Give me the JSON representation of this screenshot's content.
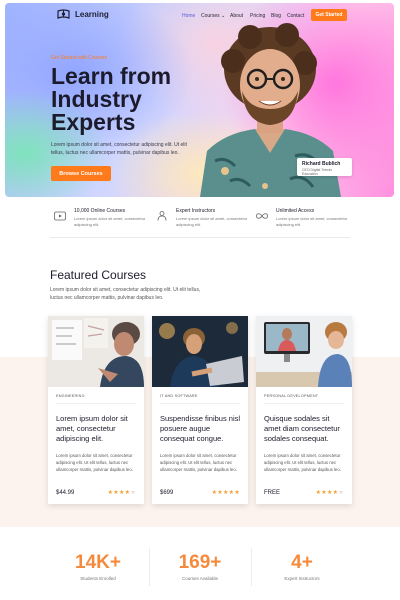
{
  "brand": {
    "name": "Learning"
  },
  "nav": {
    "items": [
      {
        "label": "Home",
        "active": true
      },
      {
        "label": "Courses ⌄",
        "active": false
      },
      {
        "label": "About",
        "active": false
      },
      {
        "label": "Pricing",
        "active": false
      },
      {
        "label": "Blog",
        "active": false
      },
      {
        "label": "Contact",
        "active": false
      }
    ],
    "cta": "Get Started"
  },
  "hero": {
    "eyebrow": "Get Started with Courses",
    "title": "Learn from Industry Experts",
    "description": "Lorem ipsum dolor sit amet, consectetur adipiscing elit. Ut elit tellus, luctus nec ullamcorper mattis, pulvinar dapibus leo.",
    "button": "Browse Courses",
    "badge": {
      "name": "Richard Bublich",
      "role": "CEO Digital Trends Education"
    }
  },
  "features": [
    {
      "icon": "video-icon",
      "title": "10,000 Online Courses",
      "desc": "Lorem ipsum dolor sit amet, consectetur adipiscing elit."
    },
    {
      "icon": "instructor-icon",
      "title": "Expert Instructors",
      "desc": "Lorem ipsum dolor sit amet, consectetur adipiscing elit."
    },
    {
      "icon": "infinity-icon",
      "title": "Unlimited Access",
      "desc": "Lorem ipsum dolor sit amet, consectetur adipiscing elit."
    }
  ],
  "featured": {
    "title": "Featured Courses",
    "description": "Lorem ipsum dolor sit amet, consectetur adipiscing elit. Ut elit tellus, luctus nec ullamcorper mattis, pulvinar dapibus leo."
  },
  "courses": [
    {
      "category": "ENGINEERING",
      "title": "Lorem ipsum dolor sit amet, consectetur adipiscing elit.",
      "desc": "Lorem ipsum dolor sit amet, consectetur adipiscing elit. Ut elit tellus, luctus nec ullamcorper mattis, pulvinar dapibus leo.",
      "price": "$44.99",
      "rating": 4
    },
    {
      "category": "IT AND SOFTWARE",
      "title": "Suspendisse finibus nisl posuere augue consequat congue.",
      "desc": "Lorem ipsum dolor sit amet, consectetur adipiscing elit. Ut elit tellus, luctus nec ullamcorper mattis, pulvinar dapibus leo.",
      "price": "$699",
      "rating": 5
    },
    {
      "category": "PERSONAL DEVELOPMENT",
      "title": "Quisque sodales sit amet diam consectetur sodales consequat.",
      "desc": "Lorem ipsum dolor sit amet, consectetur adipiscing elit. Ut elit tellus, luctus nec ullamcorper mattis, pulvinar dapibus leo.",
      "price": "FREE",
      "rating": 4
    }
  ],
  "stats": [
    {
      "value": "14K+",
      "label": "Students Enrolled"
    },
    {
      "value": "169+",
      "label": "Courses Available"
    },
    {
      "value": "4+",
      "label": "Expert Instructors"
    }
  ],
  "colors": {
    "accent": "#ff7a1a",
    "stat": "#f58a3c",
    "star": "#f0a030",
    "nav_active": "#5a5ad6"
  }
}
